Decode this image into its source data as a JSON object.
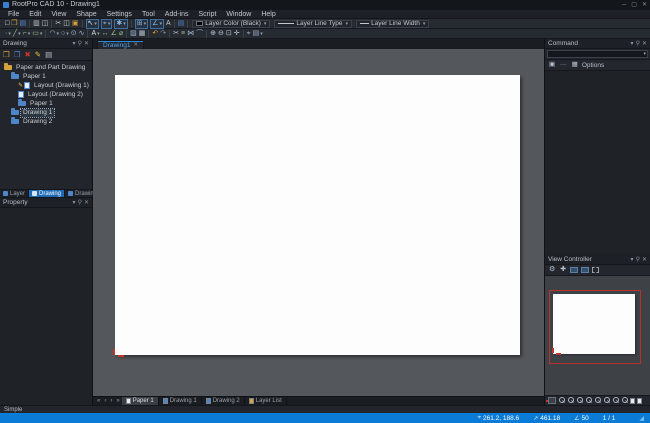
{
  "titlebar": {
    "title": "RootPro CAD 10 - Drawing1",
    "buttons": [
      {
        "name": "minimize-button",
        "glyph": "─"
      },
      {
        "name": "maximize-button",
        "glyph": "▢"
      },
      {
        "name": "close-button",
        "glyph": "✕"
      }
    ]
  },
  "menubar": {
    "items": [
      "File",
      "Edit",
      "View",
      "Shape",
      "Settings",
      "Tool",
      "Add-ins",
      "Script",
      "Window",
      "Help"
    ]
  },
  "toolbars": {
    "row1_groups": [
      {
        "icons": [
          {
            "name": "new-file-icon",
            "glyph": "□",
            "color": "#e8eaee"
          },
          {
            "name": "open-file-icon",
            "glyph": "❒",
            "color": "#d9a33c"
          },
          {
            "name": "save-icon",
            "glyph": "▤",
            "color": "#5b8dd6"
          }
        ]
      },
      {
        "icons": [
          {
            "name": "print-icon",
            "glyph": "▥",
            "color": "#c3c8cf"
          },
          {
            "name": "print-preview-icon",
            "glyph": "◫",
            "color": "#c3c8cf"
          }
        ]
      },
      {
        "icons": [
          {
            "name": "cut-icon",
            "glyph": "✂",
            "color": "#c3c8cf"
          },
          {
            "name": "copy-icon",
            "glyph": "◫",
            "color": "#c3c8cf"
          },
          {
            "name": "paste-icon",
            "glyph": "▣",
            "color": "#d9a33c"
          }
        ]
      },
      {
        "icons": [
          {
            "name": "select-mode-dropdown",
            "glyph": "↖",
            "color": "#d7dde4",
            "boxed": true,
            "dropdown": true
          },
          {
            "name": "snap-mode-dropdown",
            "glyph": "⌖",
            "color": "#8fb3d9",
            "boxed": true,
            "dropdown": true
          },
          {
            "name": "snap-point-dropdown",
            "glyph": "✱",
            "color": "#8fb3d9",
            "boxed": true,
            "dropdown": true
          }
        ]
      },
      {
        "icons": [
          {
            "name": "grid-display-dropdown",
            "glyph": "⊞",
            "color": "#8fb3d9",
            "boxed": true,
            "dropdown": true
          },
          {
            "name": "ortho-mode-dropdown",
            "glyph": "∠",
            "color": "#8fb3d9",
            "boxed": true,
            "dropdown": true
          },
          {
            "name": "numeric-input-icon",
            "glyph": "A",
            "color": "#c3c8cf"
          }
        ]
      },
      {
        "icons": [
          {
            "name": "layer-list-icon",
            "glyph": "▤",
            "color": "#4f86c9"
          }
        ]
      }
    ],
    "row1_dropdowns": [
      {
        "name": "layer-color-dropdown",
        "label": "Layer Color (Black)",
        "swatch": "black"
      },
      {
        "name": "layer-line-type-dropdown",
        "label": "Layer Line Type",
        "swatch": "longline"
      },
      {
        "name": "layer-line-width-dropdown",
        "label": "Layer Line Width",
        "swatch": "shortline"
      }
    ],
    "row2_groups": [
      {
        "icons": [
          {
            "name": "draw-point-icon",
            "glyph": "·",
            "color": "#b8c2ce",
            "dropdown": true
          },
          {
            "name": "draw-line-icon",
            "glyph": "╱",
            "color": "#9cc08c",
            "dropdown": true
          },
          {
            "name": "draw-polyline-icon",
            "glyph": "⌐",
            "color": "#9cc08c",
            "dropdown": true
          },
          {
            "name": "draw-rect-icon",
            "glyph": "▭",
            "color": "#9cc08c",
            "dropdown": true
          }
        ]
      },
      {
        "icons": [
          {
            "name": "draw-arc-icon",
            "glyph": "◠",
            "color": "#9fb6d4",
            "dropdown": true
          },
          {
            "name": "draw-circle-icon",
            "glyph": "○",
            "color": "#9fb6d4",
            "dropdown": true
          },
          {
            "name": "draw-ellipse-icon",
            "glyph": "⊙",
            "color": "#9fb6d4"
          },
          {
            "name": "draw-spline-icon",
            "glyph": "∿",
            "color": "#9fb6d4"
          }
        ]
      },
      {
        "icons": [
          {
            "name": "text-tool-icon",
            "glyph": "A",
            "color": "#d7dde4",
            "dropdown": true
          },
          {
            "name": "dimension-linear-icon",
            "glyph": "↔",
            "color": "#9cc08c"
          },
          {
            "name": "dimension-angle-icon",
            "glyph": "∠",
            "color": "#9cc08c"
          },
          {
            "name": "dimension-diameter-icon",
            "glyph": "⌀",
            "color": "#9cc08c"
          }
        ]
      },
      {
        "icons": [
          {
            "name": "hatch-icon",
            "glyph": "▨",
            "color": "#9fb6d4"
          },
          {
            "name": "insert-image-icon",
            "glyph": "▦",
            "color": "#b8c2ce"
          }
        ]
      },
      {
        "icons": [
          {
            "name": "undo-icon",
            "glyph": "↶",
            "color": "#d9a33c"
          },
          {
            "name": "redo-icon",
            "glyph": "↷",
            "color": "#8b919a"
          }
        ]
      },
      {
        "icons": [
          {
            "name": "trim-icon",
            "glyph": "✂",
            "color": "#b8c2ce"
          },
          {
            "name": "offset-icon",
            "glyph": "≡",
            "color": "#9cc08c"
          },
          {
            "name": "mirror-icon",
            "glyph": "⋈",
            "color": "#9fb6d4"
          },
          {
            "name": "fillet-icon",
            "glyph": "⌒",
            "color": "#9fb6d4"
          }
        ]
      },
      {
        "icons": [
          {
            "name": "zoom-in-icon",
            "glyph": "⊕",
            "color": "#b8c2ce"
          },
          {
            "name": "zoom-out-icon",
            "glyph": "⊖",
            "color": "#b8c2ce"
          },
          {
            "name": "zoom-extents-icon",
            "glyph": "⊡",
            "color": "#b8c2ce"
          },
          {
            "name": "pan-icon",
            "glyph": "✛",
            "color": "#b8c2ce"
          }
        ]
      },
      {
        "icons": [
          {
            "name": "measure-icon",
            "glyph": "⌖",
            "color": "#9fb6d4"
          },
          {
            "name": "properties-tool-icon",
            "glyph": "▤",
            "color": "#9fb6d4",
            "dropdown": true
          }
        ]
      }
    ]
  },
  "panel_header_buttons": [
    {
      "name": "panel-menu-icon",
      "glyph": "▾"
    },
    {
      "name": "pin-icon",
      "glyph": "⚲"
    },
    {
      "name": "close-icon",
      "glyph": "✕"
    }
  ],
  "left": {
    "drawing_panel": {
      "title": "Drawing",
      "toolbar": [
        {
          "name": "new-paper-icon",
          "glyph": "❒",
          "color": "#d9a33c"
        },
        {
          "name": "new-drawing-icon",
          "glyph": "❒",
          "color": "#4f86c9"
        },
        {
          "name": "delete-icon",
          "glyph": "✖",
          "color": "#c3362b"
        },
        {
          "name": "rename-icon",
          "glyph": "✎",
          "color": "#e5c13d"
        },
        {
          "name": "properties-icon",
          "glyph": "▤",
          "color": "#b8c2ce"
        }
      ],
      "tree": [
        {
          "label": "Paper and Part Drawing",
          "level": 0,
          "icon": "folder-yellow",
          "selected": false,
          "pencil": false
        },
        {
          "label": "Paper 1",
          "level": 1,
          "icon": "folder-blue",
          "selected": false,
          "pencil": false
        },
        {
          "label": "Layout (Drawing 1)",
          "level": 2,
          "icon": "layout",
          "selected": false,
          "pencil": true
        },
        {
          "label": "Layout (Drawing 2)",
          "level": 2,
          "icon": "layout",
          "selected": false,
          "pencil": false
        },
        {
          "label": "Paper 1",
          "level": 2,
          "icon": "folder-blue",
          "selected": false,
          "pencil": false
        },
        {
          "label": "Drawing 1",
          "level": 1,
          "icon": "folder-blue",
          "selected": true,
          "pencil": false
        },
        {
          "label": "Drawing 2",
          "level": 1,
          "icon": "folder-blue",
          "selected": false,
          "pencil": false
        }
      ]
    },
    "bottom_tabs": [
      {
        "name": "tab-layer",
        "label": "Layer",
        "active": false
      },
      {
        "name": "tab-drawing",
        "label": "Drawing",
        "active": true
      },
      {
        "name": "tab-drawing-component",
        "label": "Drawing Component",
        "active": false
      }
    ],
    "property_panel": {
      "title": "Property"
    }
  },
  "canvas": {
    "doc_tab": {
      "label": "Drawing1",
      "close_glyph": "✕"
    },
    "nav_buttons": [
      {
        "name": "sheet-nav-first-icon",
        "glyph": "«"
      },
      {
        "name": "sheet-nav-prev-icon",
        "glyph": "‹"
      },
      {
        "name": "sheet-nav-next-icon",
        "glyph": "›"
      },
      {
        "name": "sheet-nav-last-icon",
        "glyph": "»"
      }
    ],
    "bottom_tabs": [
      {
        "name": "sheet-tab-paper1",
        "label": "Paper 1",
        "active": true,
        "icon": "white"
      },
      {
        "name": "sheet-tab-drawing1",
        "label": "Drawing 1",
        "active": false,
        "icon": "blue"
      },
      {
        "name": "sheet-tab-drawing2",
        "label": "Drawing 2",
        "active": false,
        "icon": "blue"
      },
      {
        "name": "sheet-tab-layer-list",
        "label": "Layer List",
        "active": false,
        "icon": "yellow"
      }
    ]
  },
  "right": {
    "command_panel": {
      "title": "Command",
      "input_value": "",
      "icons": [
        {
          "name": "command-run-icon",
          "glyph": "▣",
          "color": "#b8c2ce"
        },
        {
          "name": "command-pause-icon",
          "glyph": "—",
          "color": "#6a7078"
        },
        {
          "name": "command-grid-icon",
          "glyph": "▦",
          "color": "#b8c2ce"
        }
      ],
      "options_label": "Options"
    },
    "view_controller": {
      "title": "View Controller",
      "toolbar": [
        {
          "name": "vc-settings-icon",
          "type": "glyph",
          "glyph": "⚙",
          "color": "#b8c2ce"
        },
        {
          "name": "vc-pan-icon",
          "type": "glyph",
          "glyph": "✚",
          "color": "#b8c2ce"
        },
        {
          "name": "vc-saved-view-1-icon",
          "type": "rect"
        },
        {
          "name": "vc-saved-view-2-icon",
          "type": "rect"
        },
        {
          "name": "vc-zoom-window-icon",
          "type": "dashed"
        }
      ],
      "zoom_buttons": [
        {
          "name": "vc-current-view-icon",
          "type": "current"
        },
        {
          "name": "vc-zoom-preset-1-icon",
          "type": "mag"
        },
        {
          "name": "vc-zoom-preset-2-icon",
          "type": "mag"
        },
        {
          "name": "vc-zoom-preset-3-icon",
          "type": "mag"
        },
        {
          "name": "vc-zoom-preset-4-icon",
          "type": "mag"
        },
        {
          "name": "vc-zoom-preset-5-icon",
          "type": "mag"
        },
        {
          "name": "vc-zoom-preset-6-icon",
          "type": "mag"
        },
        {
          "name": "vc-zoom-preset-7-icon",
          "type": "mag"
        },
        {
          "name": "vc-zoom-preset-8-icon",
          "type": "mag"
        },
        {
          "name": "vc-page-prev-icon",
          "type": "page"
        },
        {
          "name": "vc-page-next-icon",
          "type": "page"
        }
      ]
    }
  },
  "statusbar": {
    "mode_label": "Simple",
    "segments": [
      {
        "name": "status-coordinates",
        "icon": "⌖",
        "text": "261.2, 188.6"
      },
      {
        "name": "status-length",
        "icon": "↗",
        "text": "461.18"
      },
      {
        "name": "status-angle",
        "icon": "∠",
        "text": "50"
      },
      {
        "name": "status-page",
        "icon": "",
        "text": "1 / 1"
      }
    ],
    "grip_glyph": "◢"
  }
}
